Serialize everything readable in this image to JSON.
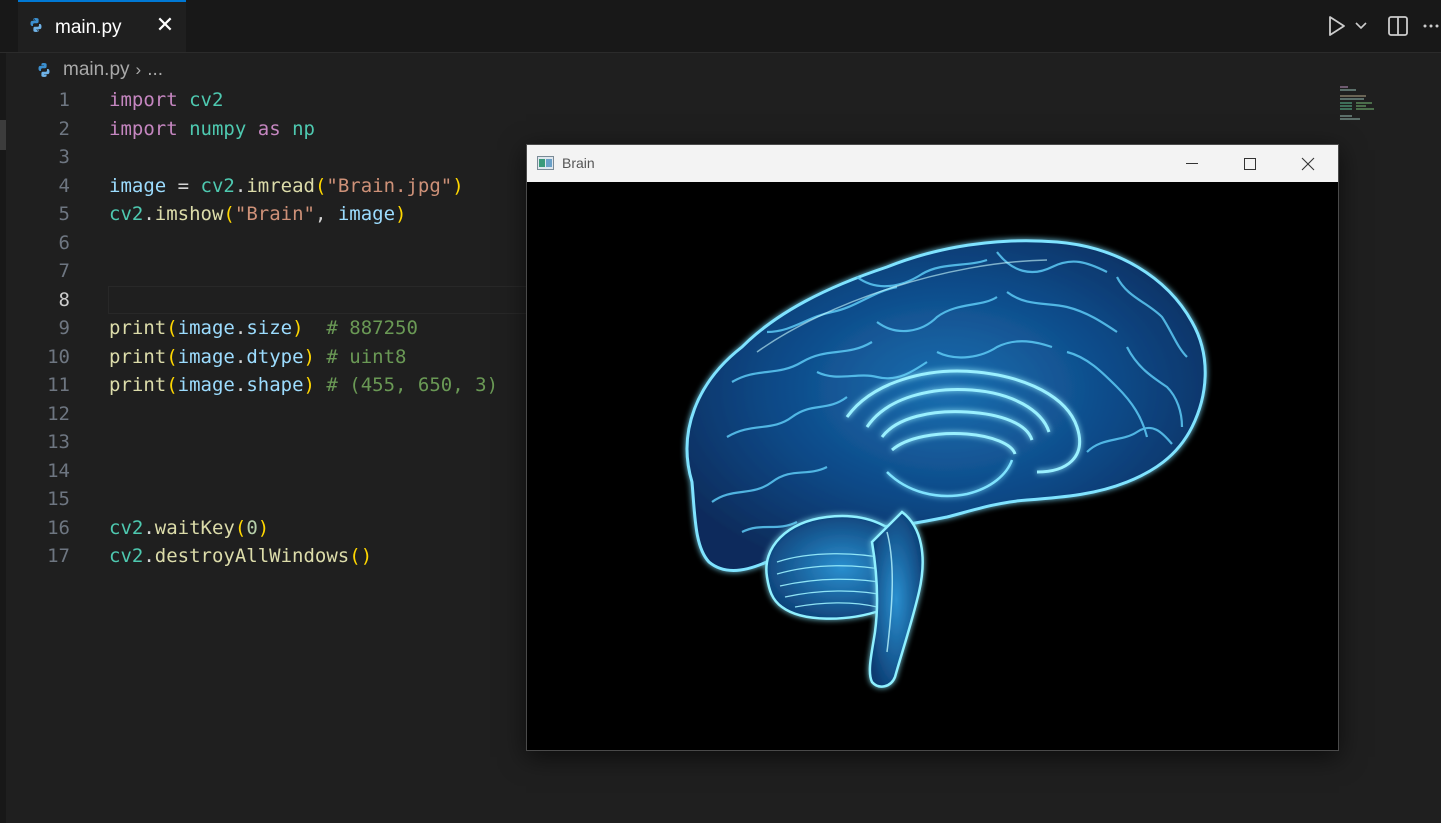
{
  "editor_tab": {
    "label": "main.py",
    "close": "✕"
  },
  "breadcrumb": {
    "file": "main.py",
    "separator": "›",
    "more": "..."
  },
  "icons": {
    "tab_icon": "python-file-icon",
    "run": "run-icon",
    "run_dropdown": "chevron-down-icon",
    "split": "split-editor-icon",
    "more": "more-actions-icon"
  },
  "code": {
    "active_line": 8,
    "lines": [
      {
        "n": "1",
        "segs": [
          {
            "t": "import",
            "c": "kw"
          },
          {
            "t": " ",
            "c": "plain"
          },
          {
            "t": "cv2",
            "c": "mod"
          }
        ]
      },
      {
        "n": "2",
        "segs": [
          {
            "t": "import",
            "c": "kw"
          },
          {
            "t": " ",
            "c": "plain"
          },
          {
            "t": "numpy",
            "c": "mod"
          },
          {
            "t": " ",
            "c": "plain"
          },
          {
            "t": "as",
            "c": "kw"
          },
          {
            "t": " ",
            "c": "plain"
          },
          {
            "t": "np",
            "c": "mod"
          }
        ]
      },
      {
        "n": "3",
        "segs": []
      },
      {
        "n": "4",
        "segs": [
          {
            "t": "image",
            "c": "var"
          },
          {
            "t": " = ",
            "c": "plain"
          },
          {
            "t": "cv2",
            "c": "mod"
          },
          {
            "t": ".",
            "c": "plain"
          },
          {
            "t": "imread",
            "c": "fn"
          },
          {
            "t": "(",
            "c": "p1"
          },
          {
            "t": "\"Brain.jpg\"",
            "c": "str"
          },
          {
            "t": ")",
            "c": "p1"
          }
        ]
      },
      {
        "n": "5",
        "segs": [
          {
            "t": "cv2",
            "c": "mod"
          },
          {
            "t": ".",
            "c": "plain"
          },
          {
            "t": "imshow",
            "c": "fn"
          },
          {
            "t": "(",
            "c": "p1"
          },
          {
            "t": "\"Brain\"",
            "c": "str"
          },
          {
            "t": ", ",
            "c": "plain"
          },
          {
            "t": "image",
            "c": "var"
          },
          {
            "t": ")",
            "c": "p1"
          }
        ]
      },
      {
        "n": "6",
        "segs": []
      },
      {
        "n": "7",
        "segs": []
      },
      {
        "n": "8",
        "segs": []
      },
      {
        "n": "9",
        "segs": [
          {
            "t": "print",
            "c": "fn"
          },
          {
            "t": "(",
            "c": "p1"
          },
          {
            "t": "image",
            "c": "var"
          },
          {
            "t": ".",
            "c": "plain"
          },
          {
            "t": "size",
            "c": "var"
          },
          {
            "t": ")",
            "c": "p1"
          },
          {
            "t": "  ",
            "c": "plain"
          },
          {
            "t": "# 887250",
            "c": "cmt"
          }
        ]
      },
      {
        "n": "10",
        "segs": [
          {
            "t": "print",
            "c": "fn"
          },
          {
            "t": "(",
            "c": "p1"
          },
          {
            "t": "image",
            "c": "var"
          },
          {
            "t": ".",
            "c": "plain"
          },
          {
            "t": "dtype",
            "c": "var"
          },
          {
            "t": ")",
            "c": "p1"
          },
          {
            "t": " ",
            "c": "plain"
          },
          {
            "t": "# uint8",
            "c": "cmt"
          }
        ]
      },
      {
        "n": "11",
        "segs": [
          {
            "t": "print",
            "c": "fn"
          },
          {
            "t": "(",
            "c": "p1"
          },
          {
            "t": "image",
            "c": "var"
          },
          {
            "t": ".",
            "c": "plain"
          },
          {
            "t": "shape",
            "c": "var"
          },
          {
            "t": ")",
            "c": "p1"
          },
          {
            "t": " ",
            "c": "plain"
          },
          {
            "t": "# (455, 650, 3)",
            "c": "cmt"
          }
        ]
      },
      {
        "n": "12",
        "segs": []
      },
      {
        "n": "13",
        "segs": []
      },
      {
        "n": "14",
        "segs": []
      },
      {
        "n": "15",
        "segs": []
      },
      {
        "n": "16",
        "segs": [
          {
            "t": "cv2",
            "c": "mod"
          },
          {
            "t": ".",
            "c": "plain"
          },
          {
            "t": "waitKey",
            "c": "fn"
          },
          {
            "t": "(",
            "c": "p1"
          },
          {
            "t": "0",
            "c": "num"
          },
          {
            "t": ")",
            "c": "p1"
          }
        ]
      },
      {
        "n": "17",
        "segs": [
          {
            "t": "cv2",
            "c": "mod"
          },
          {
            "t": ".",
            "c": "plain"
          },
          {
            "t": "destroyAllWindows",
            "c": "fn"
          },
          {
            "t": "()",
            "c": "p1"
          }
        ]
      }
    ]
  },
  "image_window": {
    "title": "Brain",
    "content": "brain-illustration",
    "colors": {
      "glow": "#7fe3ff",
      "mid": "#2a9fd8",
      "deep": "#0b3f78",
      "background": "#000000"
    }
  },
  "colors": {
    "editor_bg": "#1f1f1f",
    "tabbar_bg": "#181818",
    "accent": "#0078d4",
    "keyword": "#c586c0",
    "module": "#4ec9b0",
    "variable": "#9cdcfe",
    "function": "#dcdcaa",
    "string": "#ce9178",
    "comment": "#6a9955"
  }
}
